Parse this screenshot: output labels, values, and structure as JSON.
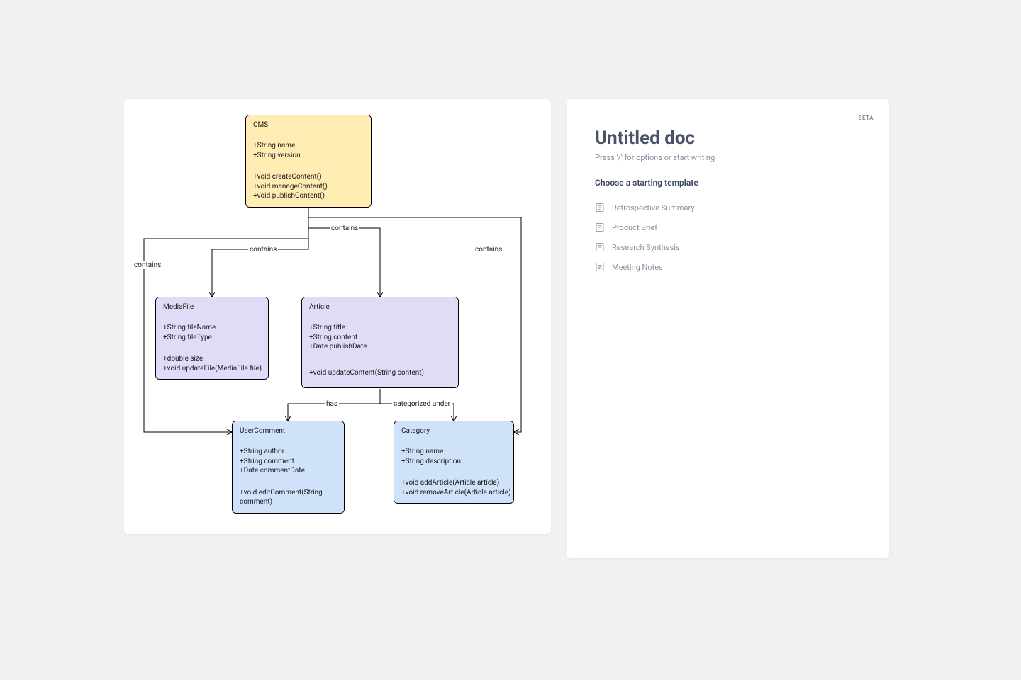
{
  "diagram": {
    "classes": {
      "cms": {
        "name": "CMS",
        "attrs": [
          "+String name",
          "+String version"
        ],
        "methods": [
          "+void createContent()",
          "+void manageContent()",
          "+void publishContent()"
        ]
      },
      "mediafile": {
        "name": "MediaFile",
        "attrs": [
          "+String fileName",
          "+String fileType"
        ],
        "methods": [
          "+double size",
          "+void updateFile(MediaFile file)"
        ]
      },
      "article": {
        "name": "Article",
        "attrs": [
          "+String title",
          "+String content",
          "+Date publishDate"
        ],
        "methods": [
          "+void updateContent(String content)"
        ]
      },
      "usercomment": {
        "name": "UserComment",
        "attrs": [
          "+String author",
          "+String comment",
          "+Date commentDate"
        ],
        "methods": [
          "+void editComment(String comment)"
        ]
      },
      "category": {
        "name": "Category",
        "attrs": [
          "+String name",
          "+String description"
        ],
        "methods": [
          "+void addArticle(Article article)",
          "+void removeArticle(Article article)"
        ]
      }
    },
    "links": {
      "l1": "contains",
      "l2": "contains",
      "l3": "contains",
      "l4": "contains",
      "l5": "has",
      "l6": "categorized under"
    }
  },
  "doc": {
    "beta": "BETA",
    "title": "Untitled doc",
    "hint": "Press '/' for options or start writing",
    "heading": "Choose a starting template",
    "templates": {
      "t0": "Retrospective Summary",
      "t1": "Product Brief",
      "t2": "Research Synthesis",
      "t3": "Meeting Notes"
    }
  }
}
